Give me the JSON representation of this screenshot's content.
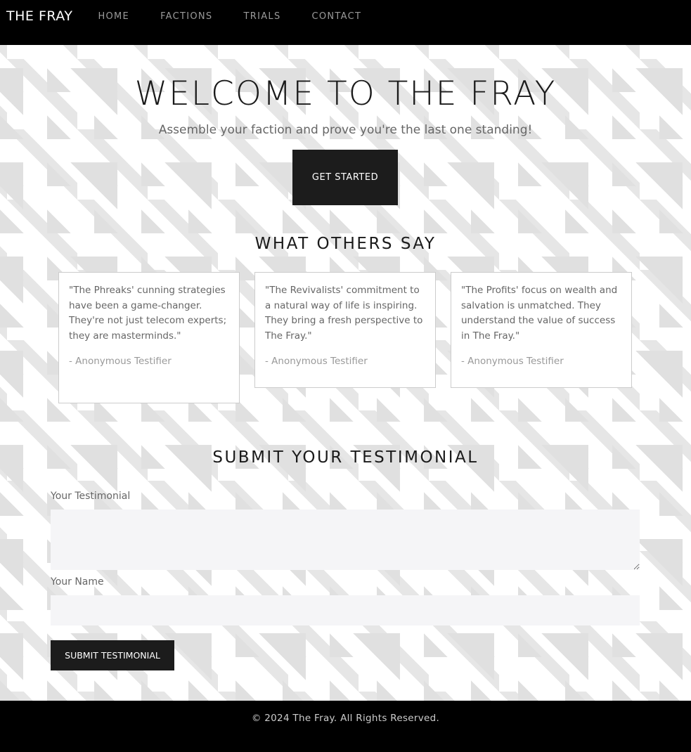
{
  "nav": {
    "brand": "THE FRAY",
    "links": [
      "HOME",
      "FACTIONS",
      "TRIALS",
      "CONTACT"
    ]
  },
  "hero": {
    "title": "WELCOME TO THE FRAY",
    "subtitle": "Assemble your faction and prove you're the last one standing!",
    "cta": "GET STARTED"
  },
  "testimonials": {
    "heading": "WHAT OTHERS SAY",
    "items": [
      {
        "quote": "\"The Phreaks' cunning strategies have been a game-changer. They're not just telecom experts; they are masterminds.\"",
        "author": "- Anonymous Testifier"
      },
      {
        "quote": "\"The Revivalists' commitment to a natural way of life is inspiring. They bring a fresh perspective to The Fray.\"",
        "author": "- Anonymous Testifier"
      },
      {
        "quote": "\"The Profits' focus on wealth and salvation is unmatched. They understand the value of success in The Fray.\"",
        "author": "- Anonymous Testifier"
      }
    ]
  },
  "form": {
    "heading": "SUBMIT YOUR TESTIMONIAL",
    "testimonial_label": "Your Testimonial",
    "testimonial_value": "",
    "name_label": "Your Name",
    "name_value": "",
    "submit": "SUBMIT TESTIMONIAL"
  },
  "footer": {
    "text": "© 2024 The Fray. All Rights Reserved."
  }
}
